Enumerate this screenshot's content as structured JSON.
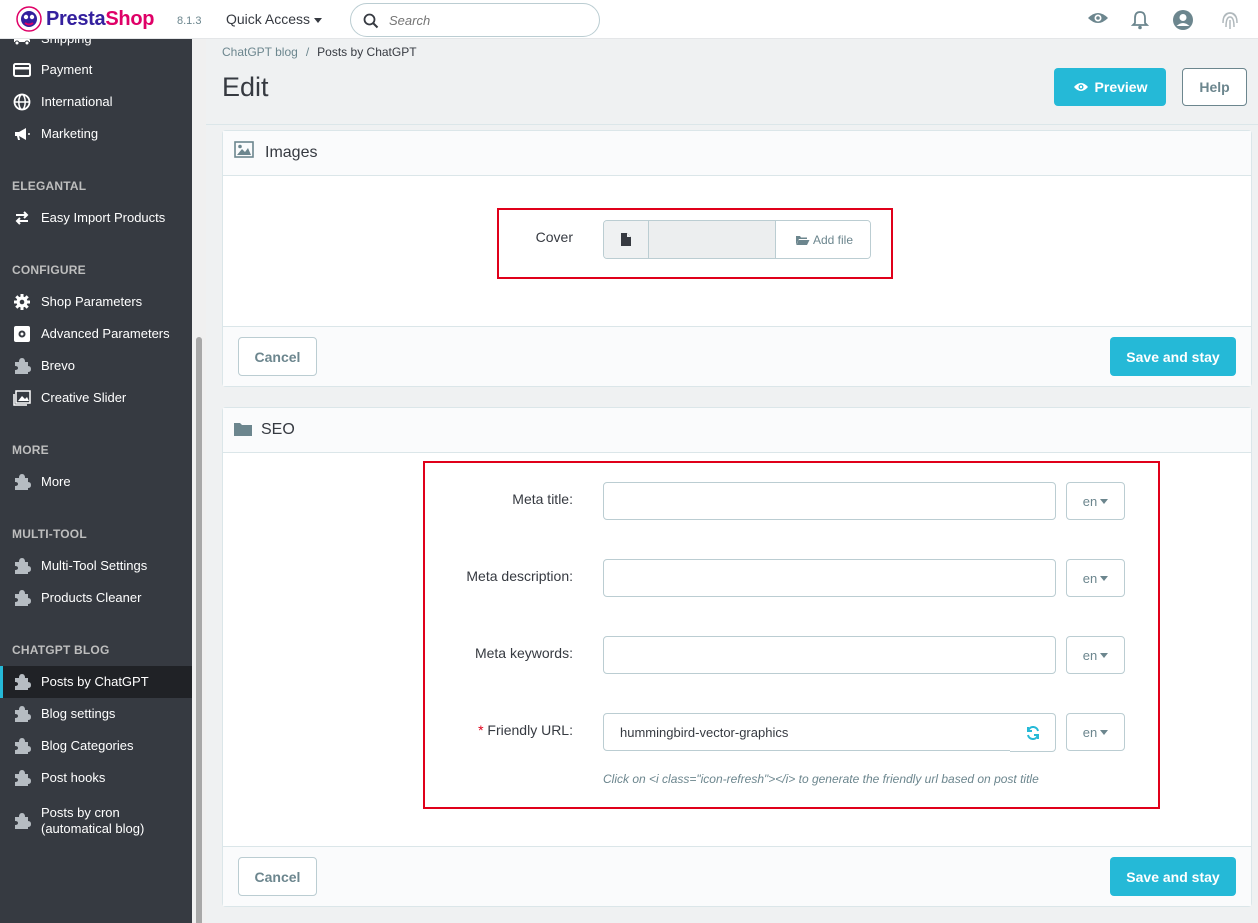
{
  "topbar": {
    "brand_part1": "Presta",
    "brand_part2": "Shop",
    "version": "8.1.3",
    "quick_access": "Quick Access",
    "search_placeholder": "Search"
  },
  "sidebar": {
    "items_top": [
      {
        "label": "Shipping",
        "icon": "truck-icon"
      },
      {
        "label": "Payment",
        "icon": "credit-card-icon"
      },
      {
        "label": "International",
        "icon": "globe-icon"
      },
      {
        "label": "Marketing",
        "icon": "megaphone-icon"
      }
    ],
    "sections": [
      {
        "title": "ELEGANTAL",
        "items": [
          {
            "label": "Easy Import Products",
            "icon": "swap-icon"
          }
        ]
      },
      {
        "title": "CONFIGURE",
        "items": [
          {
            "label": "Shop Parameters",
            "icon": "gear-icon"
          },
          {
            "label": "Advanced Parameters",
            "icon": "settings-box-icon"
          },
          {
            "label": "Brevo",
            "icon": "puzzle-icon"
          },
          {
            "label": "Creative Slider",
            "icon": "image-icon"
          }
        ]
      },
      {
        "title": "MORE",
        "items": [
          {
            "label": "More",
            "icon": "puzzle-icon"
          }
        ]
      },
      {
        "title": "MULTI-TOOL",
        "items": [
          {
            "label": "Multi-Tool Settings",
            "icon": "puzzle-icon"
          },
          {
            "label": "Products Cleaner",
            "icon": "puzzle-icon"
          }
        ]
      },
      {
        "title": "CHATGPT BLOG",
        "items": [
          {
            "label": "Posts by ChatGPT",
            "icon": "puzzle-icon",
            "active": true
          },
          {
            "label": "Blog settings",
            "icon": "puzzle-icon"
          },
          {
            "label": "Blog Categories",
            "icon": "puzzle-icon"
          },
          {
            "label": "Post hooks",
            "icon": "puzzle-icon"
          },
          {
            "label": "Posts by cron",
            "label_line2": "(automatical blog)",
            "icon": "puzzle-icon"
          }
        ]
      }
    ]
  },
  "header": {
    "breadcrumb": [
      "ChatGPT blog",
      "Posts by ChatGPT"
    ],
    "separator": "/",
    "title": "Edit",
    "preview_label": "Preview",
    "help_label": "Help"
  },
  "images_panel": {
    "title": "Images",
    "cover_label": "Cover",
    "add_file_label": "Add file",
    "cancel_label": "Cancel",
    "save_label": "Save and stay"
  },
  "seo_panel": {
    "title": "SEO",
    "meta_title_label": "Meta title:",
    "meta_description_label": "Meta description:",
    "meta_keywords_label": "Meta keywords:",
    "required_mark": "*",
    "friendly_url_label": "Friendly URL:",
    "friendly_url_value": "hummingbird-vector-graphics",
    "lang": "en",
    "help_text": "Click on <i class=\"icon-refresh\"></i> to generate the friendly url based on post title",
    "cancel_label": "Cancel",
    "save_label": "Save and stay"
  },
  "colors": {
    "accent": "#25b9d7",
    "sidebar_bg": "#363a41",
    "highlight_box": "#e0001a",
    "brand_blue": "#34209e",
    "brand_pink": "#df0067"
  }
}
